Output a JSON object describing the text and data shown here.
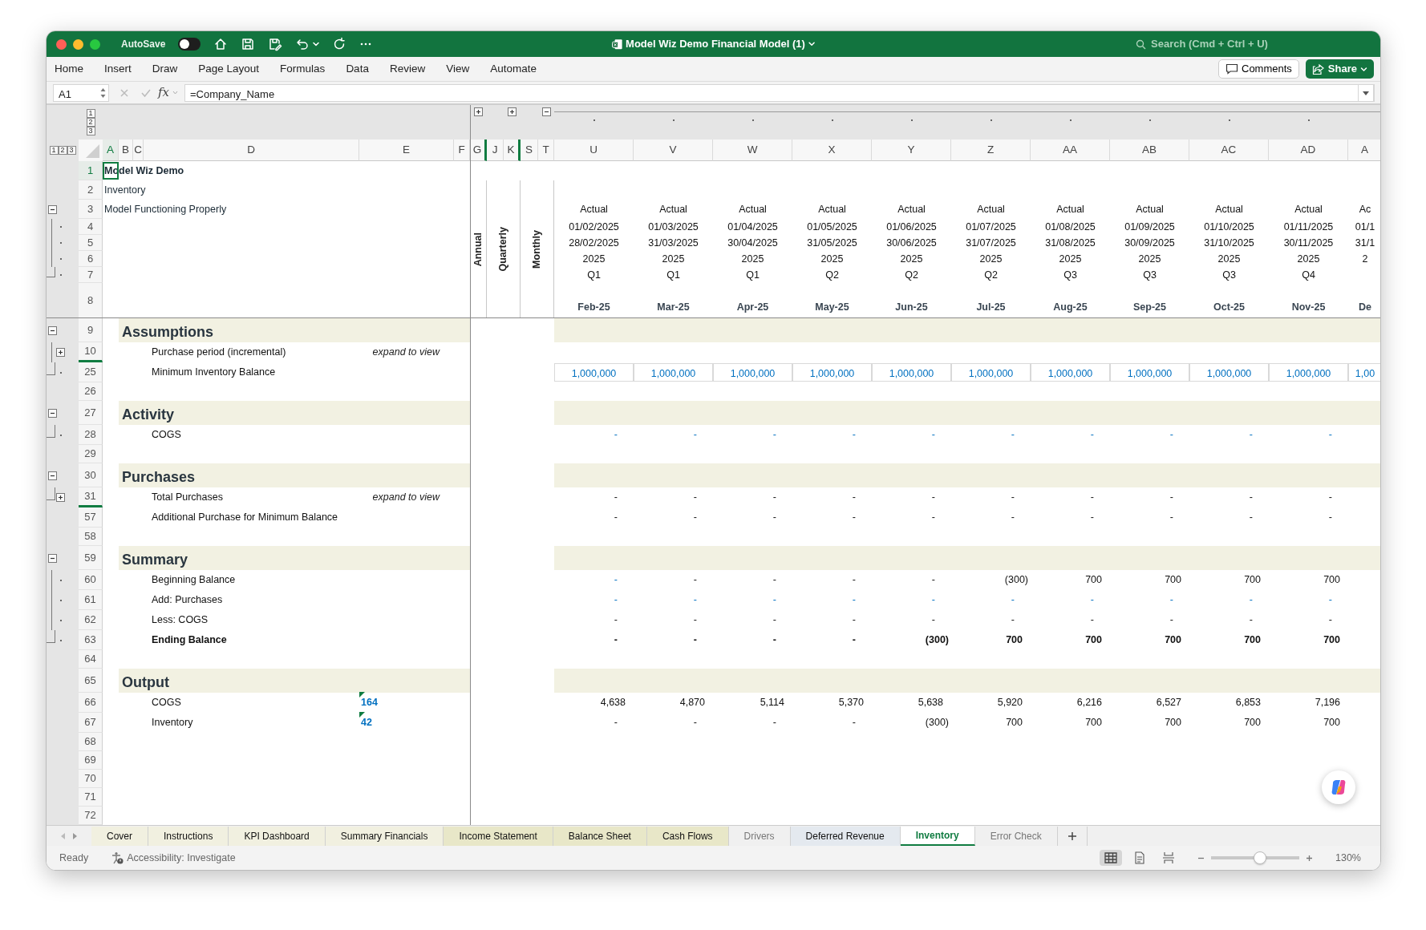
{
  "window": {
    "title": "Model Wiz Demo Financial Model (1)",
    "autosave": {
      "label": "AutoSave",
      "on": false
    },
    "search": {
      "placeholder": "Search (Cmd + Ctrl + U)"
    }
  },
  "menu": [
    "Home",
    "Insert",
    "Draw",
    "Page Layout",
    "Formulas",
    "Data",
    "Review",
    "View",
    "Automate"
  ],
  "ribbon_buttons": {
    "comments": "Comments",
    "share": "Share"
  },
  "formula_bar": {
    "name_box": "A1",
    "fx": "fx",
    "formula": "=Company_Name"
  },
  "outline_levels": {
    "rows": [
      "1",
      "2",
      "3"
    ],
    "columns": [
      "1",
      "2",
      "3"
    ]
  },
  "columns": [
    {
      "label": "A",
      "selected": true,
      "hidden_after": false
    },
    {
      "label": "B",
      "selected": false,
      "hidden_after": false
    },
    {
      "label": "C",
      "selected": false,
      "hidden_after": false
    },
    {
      "label": "D",
      "selected": false,
      "hidden_after": false
    },
    {
      "label": "E",
      "selected": false,
      "hidden_after": false
    },
    {
      "label": "F",
      "selected": false,
      "hidden_after": false
    },
    {
      "label": "G",
      "selected": false,
      "hidden_after": true,
      "outline": {
        "kind": "plus"
      }
    },
    {
      "label": "J",
      "selected": false,
      "hidden_after": false
    },
    {
      "label": "K",
      "selected": false,
      "hidden_after": true,
      "outline": {
        "kind": "plus"
      }
    },
    {
      "label": "S",
      "selected": false,
      "hidden_after": false
    },
    {
      "label": "T",
      "selected": false,
      "hidden_after": false,
      "outline": {
        "kind": "minus"
      }
    },
    {
      "label": "U",
      "selected": false,
      "hidden_after": false,
      "outline": {
        "kind": "dot"
      }
    },
    {
      "label": "V",
      "selected": false,
      "hidden_after": false,
      "outline": {
        "kind": "dot"
      }
    },
    {
      "label": "W",
      "selected": false,
      "hidden_after": false,
      "outline": {
        "kind": "dot"
      }
    },
    {
      "label": "X",
      "selected": false,
      "hidden_after": false,
      "outline": {
        "kind": "dot"
      }
    },
    {
      "label": "Y",
      "selected": false,
      "hidden_after": false,
      "outline": {
        "kind": "dot"
      }
    },
    {
      "label": "Z",
      "selected": false,
      "hidden_after": false,
      "outline": {
        "kind": "dot"
      }
    },
    {
      "label": "AA",
      "selected": false,
      "hidden_after": false,
      "outline": {
        "kind": "dot"
      }
    },
    {
      "label": "AB",
      "selected": false,
      "hidden_after": false,
      "outline": {
        "kind": "dot"
      }
    },
    {
      "label": "AC",
      "selected": false,
      "hidden_after": false,
      "outline": {
        "kind": "dot"
      }
    },
    {
      "label": "AD",
      "selected": false,
      "hidden_after": false,
      "outline": {
        "kind": "dot"
      }
    },
    {
      "label": "A",
      "selected": false,
      "hidden_after": false
    }
  ],
  "period_labels": [
    "Annual",
    "Quarterly",
    "Monthly"
  ],
  "rows": [
    {
      "num": "1",
      "kind": "title",
      "selected": true,
      "rows_hidden_below": false,
      "text": "Model Wiz Demo"
    },
    {
      "num": "2",
      "kind": "text",
      "selected": false,
      "rows_hidden_below": false,
      "text": "Inventory"
    },
    {
      "num": "3",
      "kind": "text",
      "selected": false,
      "rows_hidden_below": false,
      "outline": {
        "kind": "minus"
      },
      "text": "Model Functioning Properly",
      "timeline": [
        "Actual",
        "Actual",
        "Actual",
        "Actual",
        "Actual",
        "Actual",
        "Actual",
        "Actual",
        "Actual",
        "Actual",
        "Ac"
      ]
    },
    {
      "num": "4",
      "kind": "timeline",
      "selected": false,
      "rows_hidden_below": false,
      "outline": {
        "kind": "dot"
      },
      "timeline": [
        "01/02/2025",
        "01/03/2025",
        "01/04/2025",
        "01/05/2025",
        "01/06/2025",
        "01/07/2025",
        "01/08/2025",
        "01/09/2025",
        "01/10/2025",
        "01/11/2025",
        "01/1"
      ]
    },
    {
      "num": "5",
      "kind": "timeline",
      "selected": false,
      "rows_hidden_below": false,
      "outline": {
        "kind": "dot"
      },
      "timeline": [
        "28/02/2025",
        "31/03/2025",
        "30/04/2025",
        "31/05/2025",
        "30/06/2025",
        "31/07/2025",
        "31/08/2025",
        "30/09/2025",
        "31/10/2025",
        "30/11/2025",
        "31/1"
      ]
    },
    {
      "num": "6",
      "kind": "timeline",
      "selected": false,
      "rows_hidden_below": false,
      "outline": {
        "kind": "dot"
      },
      "timeline": [
        "2025",
        "2025",
        "2025",
        "2025",
        "2025",
        "2025",
        "2025",
        "2025",
        "2025",
        "2025",
        "2"
      ]
    },
    {
      "num": "7",
      "kind": "timeline",
      "selected": false,
      "rows_hidden_below": false,
      "outline": {
        "kind": "last"
      },
      "timeline": [
        "Q1",
        "Q1",
        "Q1",
        "Q2",
        "Q2",
        "Q2",
        "Q3",
        "Q3",
        "Q3",
        "Q4"
      ]
    },
    {
      "num": "8",
      "kind": "timeline_label",
      "selected": false,
      "rows_hidden_below": false,
      "timeline": [
        "Feb-25",
        "Mar-25",
        "Apr-25",
        "May-25",
        "Jun-25",
        "Jul-25",
        "Aug-25",
        "Sep-25",
        "Oct-25",
        "Nov-25",
        "De"
      ]
    },
    {
      "num": "9",
      "kind": "section",
      "selected": false,
      "rows_hidden_below": false,
      "outline": {
        "kind": "minus"
      },
      "text": "Assumptions"
    },
    {
      "num": "10",
      "kind": "line",
      "selected": false,
      "rows_hidden_below": true,
      "outline": {
        "kind": "plus"
      },
      "bold": false,
      "label": "Purchase period (incremental)",
      "note": "expand to view"
    },
    {
      "num": "25",
      "kind": "line",
      "selected": false,
      "rows_hidden_below": false,
      "outline": {
        "kind": "last"
      },
      "bold": false,
      "label": "Minimum Inventory Balance",
      "value_style": {
        "kind": "input"
      },
      "values": [
        "1,000,000",
        "1,000,000",
        "1,000,000",
        "1,000,000",
        "1,000,000",
        "1,000,000",
        "1,000,000",
        "1,000,000",
        "1,000,000",
        "1,000,000",
        "1,00"
      ]
    },
    {
      "num": "26",
      "kind": "blank",
      "selected": false,
      "rows_hidden_below": false
    },
    {
      "num": "27",
      "kind": "section",
      "selected": false,
      "rows_hidden_below": false,
      "outline": {
        "kind": "minus"
      },
      "text": "Activity"
    },
    {
      "num": "28",
      "kind": "line",
      "selected": false,
      "rows_hidden_below": false,
      "outline": {
        "kind": "last"
      },
      "bold": false,
      "label": "COGS",
      "value_style": {
        "kind": "link"
      },
      "values": [
        "-",
        "-",
        "-",
        "-",
        "-",
        "-",
        "-",
        "-",
        "-",
        "-"
      ]
    },
    {
      "num": "29",
      "kind": "blank",
      "selected": false,
      "rows_hidden_below": false
    },
    {
      "num": "30",
      "kind": "section",
      "selected": false,
      "rows_hidden_below": false,
      "outline": {
        "kind": "minus"
      },
      "text": "Purchases"
    },
    {
      "num": "31",
      "kind": "line",
      "selected": false,
      "rows_hidden_below": true,
      "outline": {
        "kind": "plus_last"
      },
      "bold": false,
      "label": "Total Purchases",
      "note": "expand to view",
      "value_style": {
        "kind": "calc"
      },
      "values": [
        "-",
        "-",
        "-",
        "-",
        "-",
        "-",
        "-",
        "-",
        "-",
        "-"
      ]
    },
    {
      "num": "57",
      "kind": "line",
      "selected": false,
      "rows_hidden_below": false,
      "bold": false,
      "label": "Additional Purchase for Minimum Balance",
      "value_style": {
        "kind": "calc"
      },
      "values": [
        "-",
        "-",
        "-",
        "-",
        "-",
        "-",
        "-",
        "-",
        "-",
        "-"
      ]
    },
    {
      "num": "58",
      "kind": "blank",
      "selected": false,
      "rows_hidden_below": false
    },
    {
      "num": "59",
      "kind": "section",
      "selected": false,
      "rows_hidden_below": false,
      "outline": {
        "kind": "minus"
      },
      "text": "Summary"
    },
    {
      "num": "60",
      "kind": "line",
      "selected": false,
      "rows_hidden_below": false,
      "outline": {
        "kind": "dot"
      },
      "bold": false,
      "label": "Beginning Balance",
      "value_style": {
        "kind": "calc"
      },
      "values": [
        {
          "text": "-",
          "kind": "link"
        },
        "-",
        "-",
        "-",
        "-",
        "(300)",
        "700",
        "700",
        "700",
        "700"
      ]
    },
    {
      "num": "61",
      "kind": "line",
      "selected": false,
      "rows_hidden_below": false,
      "outline": {
        "kind": "dot"
      },
      "bold": false,
      "label": "Add: Purchases",
      "value_style": {
        "kind": "link"
      },
      "values": [
        "-",
        "-",
        "-",
        "-",
        "-",
        "-",
        "-",
        "-",
        "-",
        "-"
      ]
    },
    {
      "num": "62",
      "kind": "line",
      "selected": false,
      "rows_hidden_below": false,
      "outline": {
        "kind": "dot"
      },
      "bold": false,
      "label": "Less: COGS",
      "value_style": {
        "kind": "calc"
      },
      "values": [
        "-",
        "-",
        "-",
        "-",
        "-",
        "-",
        "-",
        "-",
        "-",
        "-"
      ]
    },
    {
      "num": "63",
      "kind": "line",
      "selected": false,
      "rows_hidden_below": false,
      "outline": {
        "kind": "last"
      },
      "bold": true,
      "label": "Ending Balance",
      "value_style": {
        "kind": "calc"
      },
      "values": [
        "-",
        "-",
        "-",
        "-",
        "(300)",
        "700",
        "700",
        "700",
        "700",
        "700"
      ]
    },
    {
      "num": "64",
      "kind": "blank",
      "selected": false,
      "rows_hidden_below": false
    },
    {
      "num": "65",
      "kind": "section",
      "selected": false,
      "rows_hidden_below": false,
      "text": "Output"
    },
    {
      "num": "66",
      "kind": "line",
      "selected": false,
      "rows_hidden_below": false,
      "bold": false,
      "label": "COGS",
      "e_value": "164",
      "flagged": true,
      "value_style": {
        "kind": "calc"
      },
      "values": [
        "4,638",
        "4,870",
        "5,114",
        "5,370",
        "5,638",
        "5,920",
        "6,216",
        "6,527",
        "6,853",
        "7,196"
      ]
    },
    {
      "num": "67",
      "kind": "line",
      "selected": false,
      "rows_hidden_below": false,
      "bold": false,
      "label": "Inventory",
      "e_value": "42",
      "flagged": true,
      "value_style": {
        "kind": "calc"
      },
      "values": [
        "-",
        "-",
        "-",
        "-",
        "(300)",
        "700",
        "700",
        "700",
        "700",
        "700"
      ]
    },
    {
      "num": "68",
      "kind": "blank",
      "selected": false,
      "rows_hidden_below": false
    },
    {
      "num": "69",
      "kind": "blank",
      "selected": false,
      "rows_hidden_below": false
    },
    {
      "num": "70",
      "kind": "blank",
      "selected": false,
      "rows_hidden_below": false
    },
    {
      "num": "71",
      "kind": "blank",
      "selected": false,
      "rows_hidden_below": false
    },
    {
      "num": "72",
      "kind": "blank",
      "selected": false,
      "rows_hidden_below": false
    }
  ],
  "sheet_tabs": [
    {
      "label": "Cover",
      "selected": false,
      "color": "#f1f0e0"
    },
    {
      "label": "Instructions",
      "selected": false,
      "color": "#f1f0e0"
    },
    {
      "label": "KPI Dashboard",
      "selected": false,
      "color": "#f1f0e0"
    },
    {
      "label": "Summary Financials",
      "selected": false,
      "color": "#f1f0e0"
    },
    {
      "label": "Income Statement",
      "selected": false,
      "color": "#e8e7c8"
    },
    {
      "label": "Balance Sheet",
      "selected": false,
      "color": "#e8e7c8"
    },
    {
      "label": "Cash Flows",
      "selected": false,
      "color": "#e8e7c8"
    },
    {
      "label": "Drivers",
      "selected": false
    },
    {
      "label": "Deferred Revenue",
      "selected": false,
      "color": "#e4e9ef"
    },
    {
      "label": "Inventory",
      "selected": true
    },
    {
      "label": "Error Check",
      "selected": false
    }
  ],
  "status_bar": {
    "ready": "Ready",
    "accessibility": "Accessibility: Investigate",
    "views": [
      {
        "kind": "normal",
        "selected": true
      },
      {
        "kind": "page_layout",
        "selected": false
      },
      {
        "kind": "page_break",
        "selected": false
      }
    ],
    "zoom_slider": {
      "level": 0.55
    },
    "zoom": "130%"
  }
}
